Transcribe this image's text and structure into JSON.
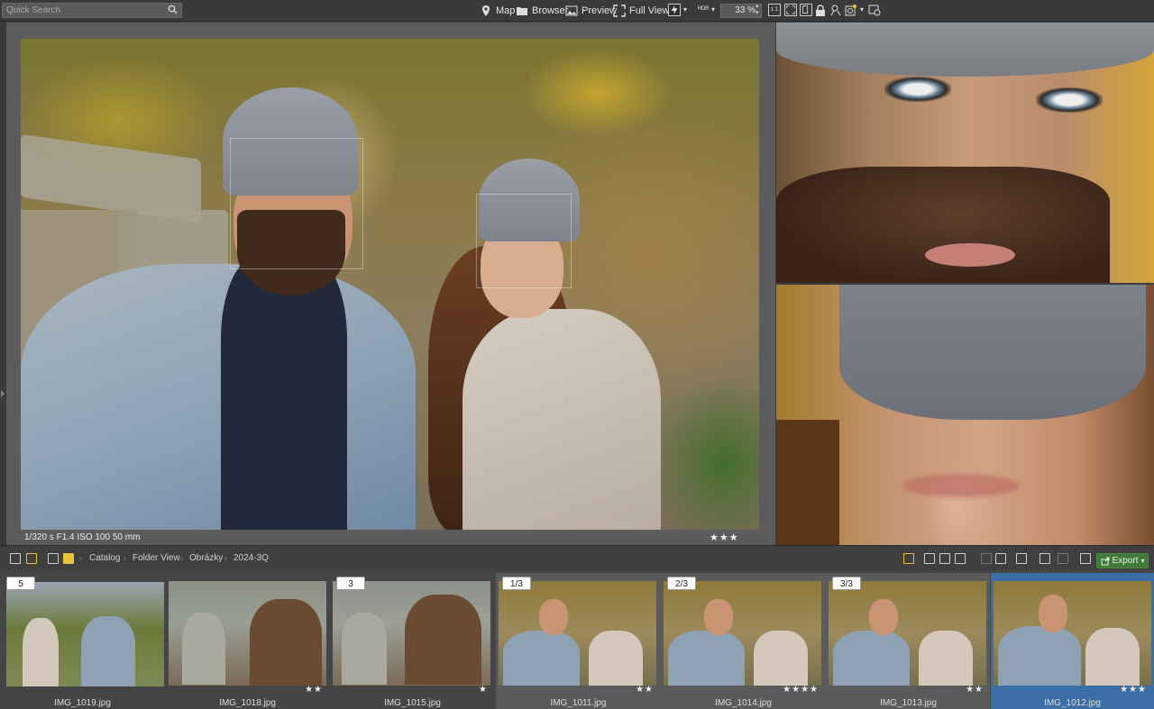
{
  "search": {
    "placeholder": "Quick Search"
  },
  "toolbar": {
    "map_label": "Map",
    "browser_label": "Browser",
    "preview_label": "Preview",
    "fullview_label": "Full View",
    "hdr_label": "HDR",
    "zoom_value": "33 %",
    "icons": [
      "map-pin-icon",
      "folder-icon",
      "image-icon",
      "fullview-icon",
      "flash-icon",
      "hdr-icon",
      "zoom-1to1-icon",
      "fit-icon",
      "split-icon",
      "lock-icon",
      "compare-icon",
      "focus-icon",
      "settings-icon"
    ]
  },
  "photo": {
    "exif": "1/320 s   F1.4   ISO 100   50 mm",
    "stars": "★★★"
  },
  "breadcrumb": {
    "items": [
      "Catalog",
      "Folder View",
      "Obrázky",
      "2024-3Q"
    ]
  },
  "actions": {
    "export_label": "Export"
  },
  "filmstrip": [
    {
      "badge": "5",
      "name": "IMG_1019.jpg",
      "stars": ""
    },
    {
      "badge": "",
      "name": "IMG_1018.jpg",
      "stars": "★★"
    },
    {
      "badge": "3",
      "name": "IMG_1015.jpg",
      "stars": "★"
    },
    {
      "badge": "1/3",
      "name": "IMG_1011.jpg",
      "stars": "★★"
    },
    {
      "badge": "2/3",
      "name": "IMG_1014.jpg",
      "stars": "★★★★"
    },
    {
      "badge": "3/3",
      "name": "IMG_1013.jpg",
      "stars": "★★"
    },
    {
      "badge": "",
      "name": "IMG_1012.jpg",
      "stars": "★★★"
    }
  ],
  "colors": {
    "accent_selected": "#3a6ea5",
    "export_green": "#3f7a3a"
  }
}
